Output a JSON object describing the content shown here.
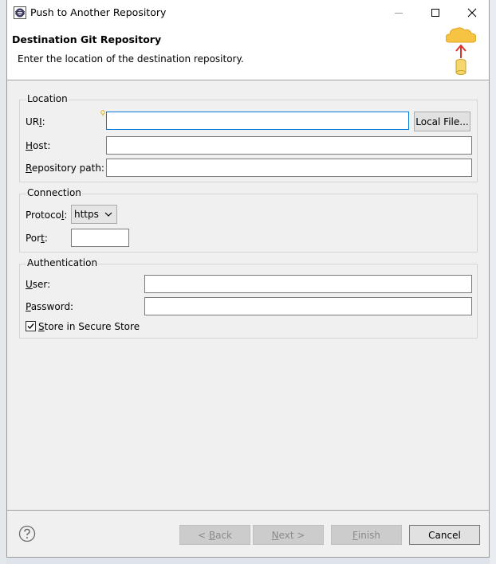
{
  "window": {
    "title": "Push to Another Repository",
    "icon": "eclipse-app-icon",
    "controls": [
      "minimize-icon",
      "maximize-icon",
      "close-icon"
    ]
  },
  "banner": {
    "title": "Destination Git Repository",
    "description": "Enter the location of the destination repository.",
    "graphic": "cloud-push-icon"
  },
  "location": {
    "group_label": "Location",
    "uri_label_prefix": "UR",
    "uri_label_mnemonic": "I",
    "uri_label_suffix": ":",
    "uri_value": "",
    "local_file_button": "Local File...",
    "host_label_mnemonic": "H",
    "host_label_rest": "ost:",
    "host_value": "",
    "repo_path_label_mnemonic": "R",
    "repo_path_label_rest": "epository path:",
    "repo_path_value": ""
  },
  "connection": {
    "group_label": "Connection",
    "protocol_label_prefix": "Protoco",
    "protocol_label_mnemonic": "l",
    "protocol_label_suffix": ":",
    "protocol_value": "https",
    "port_label_prefix": "Por",
    "port_label_mnemonic": "t",
    "port_label_suffix": ":",
    "port_value": ""
  },
  "authentication": {
    "group_label": "Authentication",
    "user_label_mnemonic": "U",
    "user_label_rest": "ser:",
    "user_value": "",
    "password_label_mnemonic": "P",
    "password_label_rest": "assword:",
    "password_value": "",
    "store_mnemonic": "S",
    "store_rest": "tore in Secure Store",
    "store_checked": true
  },
  "footer": {
    "help_icon": "help-icon",
    "back_prefix": "< ",
    "back_mnemonic": "B",
    "back_rest": "ack",
    "next_mnemonic": "N",
    "next_rest": "ext >",
    "finish_mnemonic": "F",
    "finish_rest": "inish",
    "cancel": "Cancel"
  },
  "colors": {
    "focus_border": "#0078d7",
    "dialog_bg": "#f0f0f0",
    "disabled_text": "#8b8b8b"
  }
}
